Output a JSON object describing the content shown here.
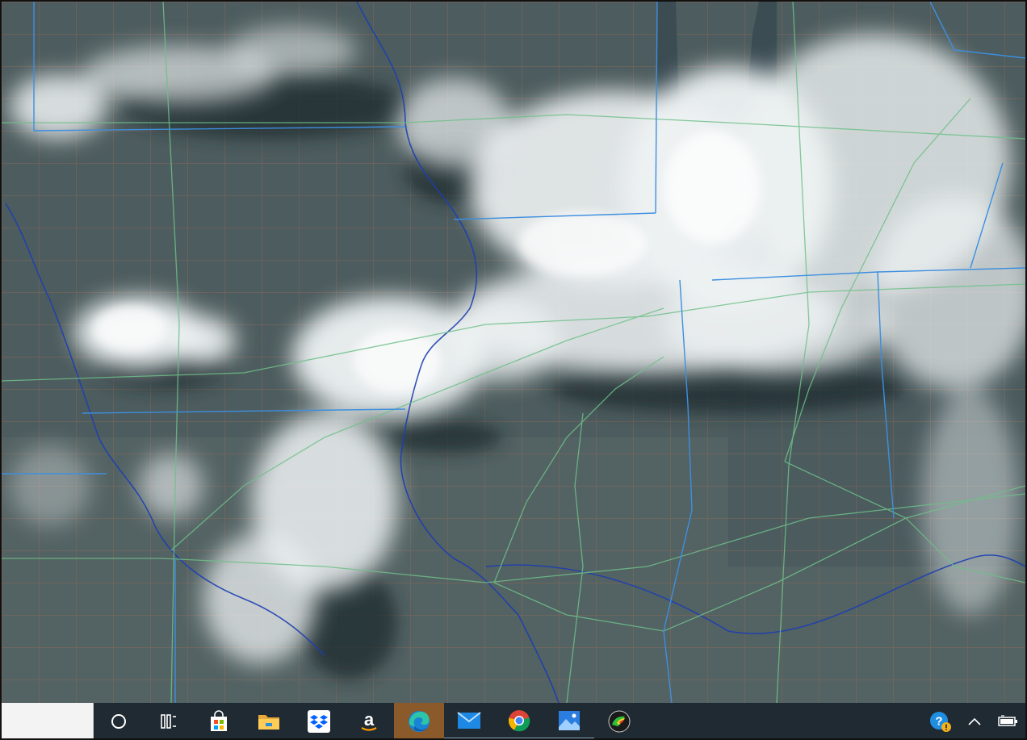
{
  "desktop": {
    "wallpaper": "satellite-weather-image",
    "colors": {
      "ground": "#4d5c5e",
      "cloud": "#eef2f3",
      "county_lines": "#9a6a55",
      "state_lines": "#3d8fe0",
      "highways": "#6fc08a",
      "rivers": "#1d3fb0"
    }
  },
  "taskbar": {
    "background": "#1f2a33",
    "search_box": {
      "placeholder": ""
    },
    "buttons": [
      {
        "id": "cortana",
        "icon": "circle-icon",
        "active": false,
        "running": false
      },
      {
        "id": "task-view",
        "icon": "task-view-icon",
        "active": false,
        "running": false
      },
      {
        "id": "store",
        "icon": "microsoft-store-icon",
        "active": false,
        "running": false
      },
      {
        "id": "file-explorer",
        "icon": "folder-icon",
        "active": false,
        "running": false
      },
      {
        "id": "dropbox",
        "icon": "dropbox-icon",
        "active": false,
        "running": false
      },
      {
        "id": "amazon",
        "icon": "amazon-icon",
        "active": false,
        "running": false
      },
      {
        "id": "edge",
        "icon": "edge-icon",
        "active": true,
        "running": false
      },
      {
        "id": "mail",
        "icon": "mail-icon",
        "active": false,
        "running": true
      },
      {
        "id": "chrome",
        "icon": "chrome-icon",
        "active": false,
        "running": true
      },
      {
        "id": "photos",
        "icon": "photos-icon",
        "active": false,
        "running": true
      },
      {
        "id": "radar",
        "icon": "radar-app-icon",
        "active": false,
        "running": false
      }
    ],
    "tray": [
      {
        "id": "help",
        "icon": "help-icon"
      },
      {
        "id": "show-hidden",
        "icon": "chevron-up-icon"
      },
      {
        "id": "battery",
        "icon": "battery-icon"
      }
    ]
  }
}
